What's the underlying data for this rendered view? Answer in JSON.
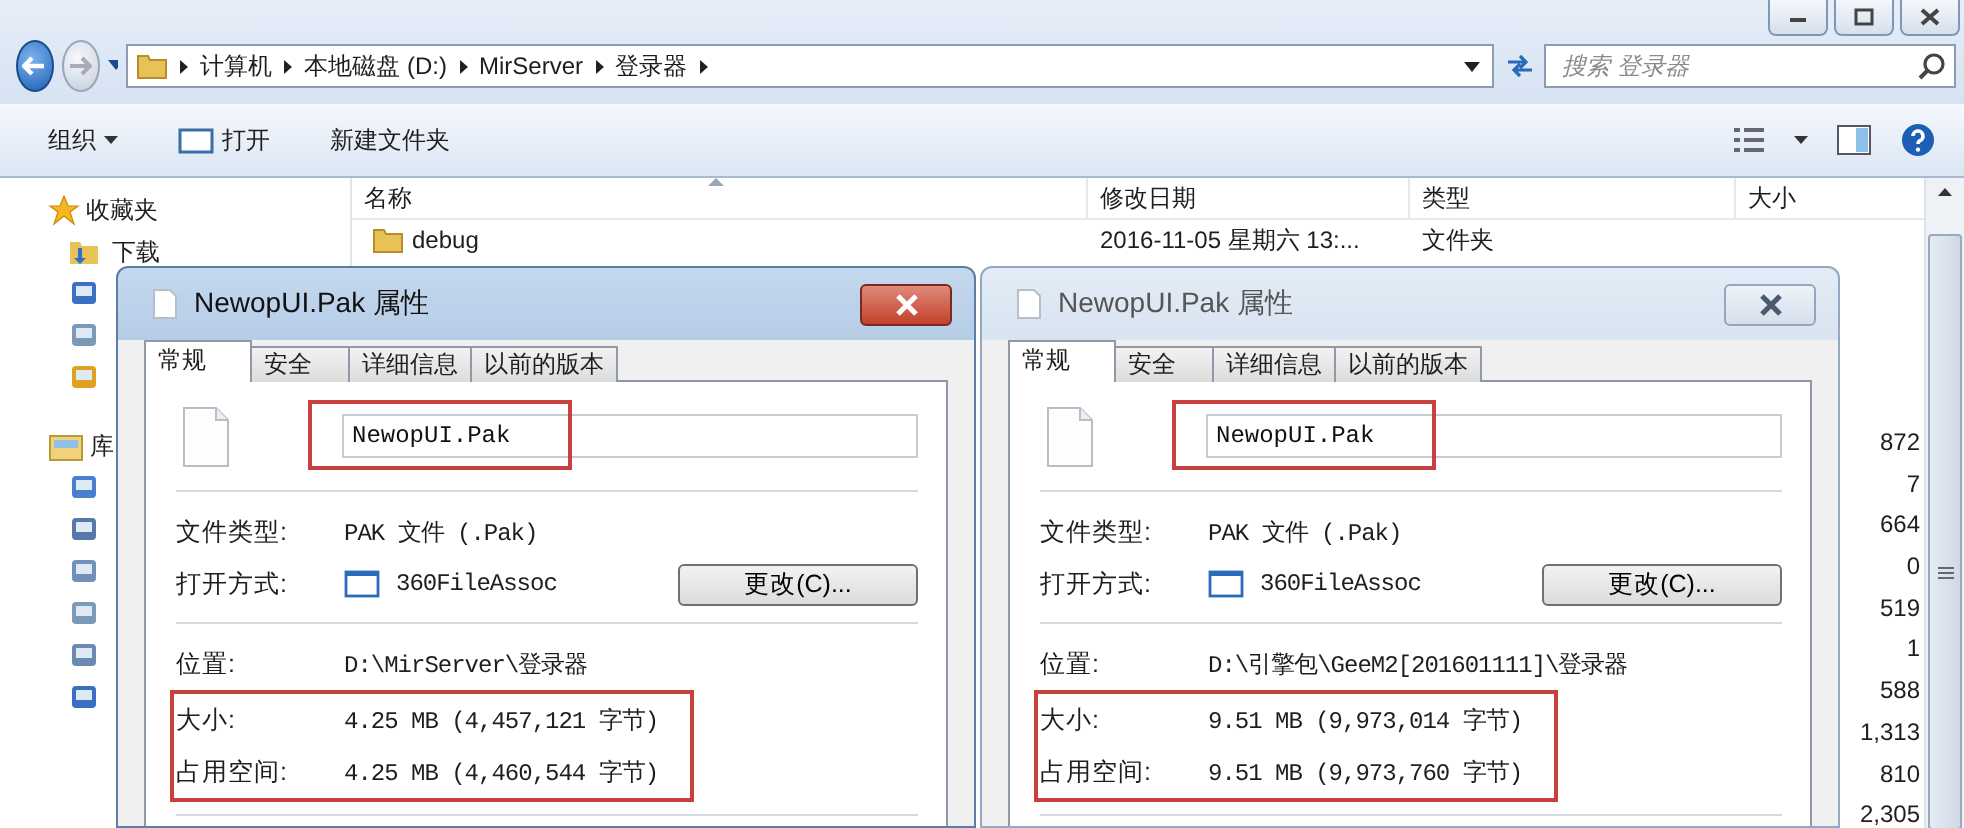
{
  "address_bar": {
    "path": [
      "计算机",
      "本地磁盘 (D:)",
      "MirServer",
      "登录器"
    ]
  },
  "search": {
    "placeholder": "搜索 登录器"
  },
  "toolbar": {
    "items": [
      {
        "label": "组织",
        "kind": "menu"
      },
      {
        "label": "打开",
        "kind": "open"
      },
      {
        "label": "新建文件夹",
        "kind": "plain"
      }
    ]
  },
  "navigation": {
    "items": [
      {
        "label": "收藏夹",
        "kind": "group"
      },
      {
        "label": "下载",
        "kind": "item"
      },
      {
        "kind": "item"
      },
      {
        "kind": "item"
      },
      {
        "kind": "item"
      },
      {
        "label": "库",
        "kind": "group"
      },
      {
        "kind": "item"
      },
      {
        "kind": "item"
      },
      {
        "kind": "item"
      },
      {
        "kind": "item"
      },
      {
        "kind": "item"
      },
      {
        "kind": "item"
      }
    ]
  },
  "file_list": {
    "columns": [
      "名称",
      "修改日期",
      "类型",
      "大小"
    ],
    "rows": [
      {
        "name": "debug",
        "modified": "2016-11-05 星期六 13:...",
        "type": "文件夹"
      }
    ],
    "size_column": [
      "872",
      "7",
      "664",
      "0",
      "519",
      "1",
      "588",
      "1,313",
      "810",
      "2,305"
    ]
  },
  "dialogs": [
    {
      "title": "NewopUI.Pak 属性",
      "active": true,
      "tabs": [
        {
          "label": "常规",
          "selected": true
        },
        {
          "label": "安全",
          "selected": false
        },
        {
          "label": "详细信息",
          "selected": false
        },
        {
          "label": "以前的版本",
          "selected": false
        }
      ],
      "file_name": "NewopUI.Pak",
      "name_highlighted": true,
      "sections": [
        [
          {
            "kind": "text",
            "label": "文件类型:",
            "value": "PAK 文件 (.Pak)",
            "highlighted": false
          },
          {
            "kind": "app",
            "label": "打开方式:",
            "value": "360FileAssoc",
            "button": "更改(C)...",
            "highlighted": false
          }
        ],
        [
          {
            "kind": "text",
            "label": "位置:",
            "value": "D:\\MirServer\\登录器",
            "highlighted": false
          },
          {
            "kind": "text",
            "label": "大小:",
            "value": "4.25 MB (4,457,121 字节)",
            "highlighted": true
          },
          {
            "kind": "text",
            "label": "占用空间:",
            "value": "4.25 MB (4,460,544 字节)",
            "highlighted": true
          }
        ]
      ]
    },
    {
      "title": "NewopUI.Pak 属性",
      "active": false,
      "tabs": [
        {
          "label": "常规",
          "selected": true
        },
        {
          "label": "安全",
          "selected": false
        },
        {
          "label": "详细信息",
          "selected": false
        },
        {
          "label": "以前的版本",
          "selected": false
        }
      ],
      "file_name": "NewopUI.Pak",
      "name_highlighted": true,
      "sections": [
        [
          {
            "kind": "text",
            "label": "文件类型:",
            "value": "PAK 文件 (.Pak)",
            "highlighted": false
          },
          {
            "kind": "app",
            "label": "打开方式:",
            "value": "360FileAssoc",
            "button": "更改(C)...",
            "highlighted": false
          }
        ],
        [
          {
            "kind": "text",
            "label": "位置:",
            "value": "D:\\引擎包\\GeeM2[201601111]\\登录器",
            "highlighted": false
          },
          {
            "kind": "text",
            "label": "大小:",
            "value": "9.51 MB (9,973,014 字节)",
            "highlighted": true
          },
          {
            "kind": "text",
            "label": "占用空间:",
            "value": "9.51 MB (9,973,760 字节)",
            "highlighted": true
          }
        ]
      ]
    }
  ]
}
